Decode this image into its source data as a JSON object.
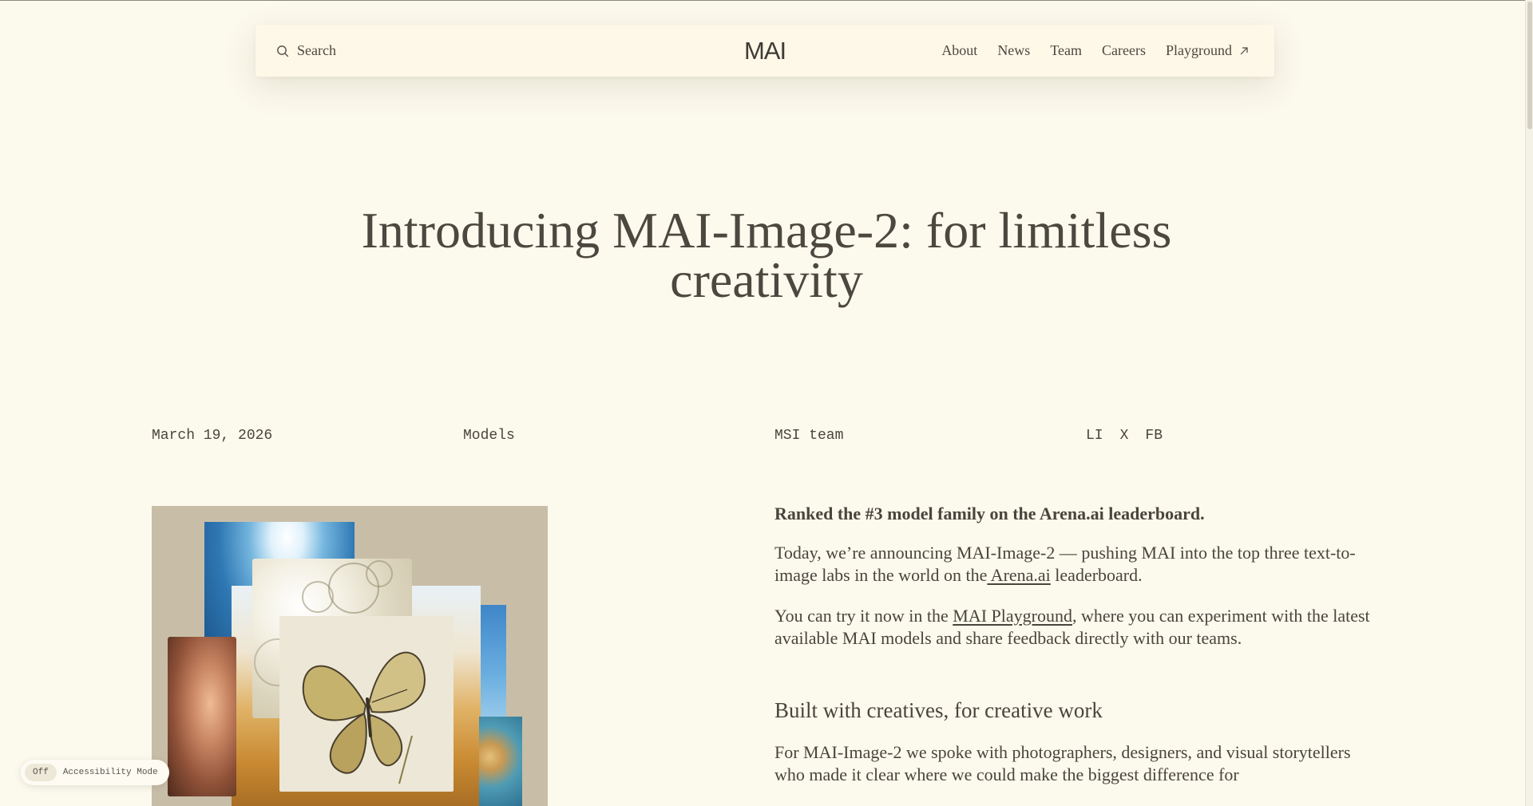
{
  "header": {
    "search_label": "Search",
    "logo": "MAI",
    "nav": [
      "About",
      "News",
      "Team",
      "Careers",
      "Playground"
    ]
  },
  "article": {
    "title": "Introducing MAI-Image-2: for limitless creativity",
    "date": "March 19, 2026",
    "category": "Models",
    "author": "MSI team",
    "share": [
      "LI",
      "X",
      "FB"
    ],
    "lead": "Ranked the #3 model family on the Arena.ai leaderboard.",
    "p1": {
      "before": "Today, we’re announcing MAI-Image-2 — pushing MAI into the top three text-to-image labs in the world on the",
      "link": " Arena.ai",
      "after": " leaderboard."
    },
    "p2": {
      "before": "You can try it now in the ",
      "link": "MAI Playground",
      "after": ", where you can experiment with the latest available MAI models and share feedback directly with our teams."
    },
    "section_title": "Built with creatives, for creative work",
    "p3": "For MAI-Image-2 we spoke with photographers, designers, and visual storytellers who made it clear where we could make the biggest difference for"
  },
  "accessibility": {
    "state": "Off",
    "label": "Accessibility Mode"
  },
  "icons": {
    "search": "search-icon",
    "external": "arrow-up-right-icon"
  }
}
